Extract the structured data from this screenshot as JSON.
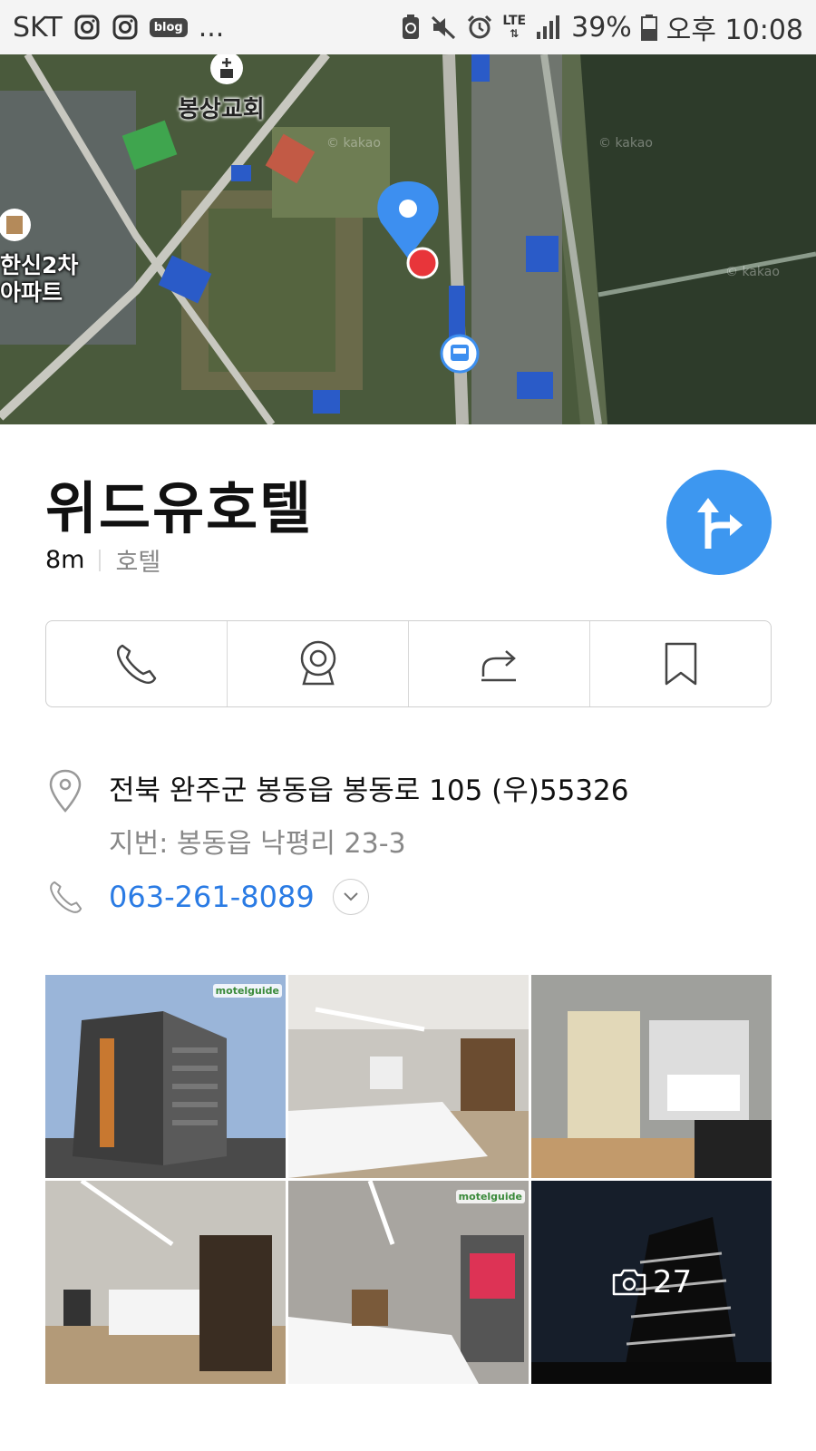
{
  "status_bar": {
    "carrier": "SKT",
    "blog_badge": "blog",
    "more": "...",
    "network": "LTE",
    "battery": "39%",
    "time": "오후 10:08"
  },
  "map": {
    "church_label": "봉상교회",
    "apartment_label_line1": "한신2차",
    "apartment_label_line2": "아파트",
    "watermark": "© kakao"
  },
  "place": {
    "name": "위드유호텔",
    "distance": "8m",
    "category": "호텔"
  },
  "info": {
    "address": "전북 완주군 봉동읍 봉동로 105 (우)55326",
    "lot_address": "지번: 봉동읍 낙평리 23-3",
    "phone": "063-261-8089"
  },
  "photos": {
    "logo_text": "motelguide",
    "more_count": "27"
  },
  "colors": {
    "accent": "#3d97f0",
    "link": "#2a7be4",
    "marker_red": "#e8353a"
  }
}
